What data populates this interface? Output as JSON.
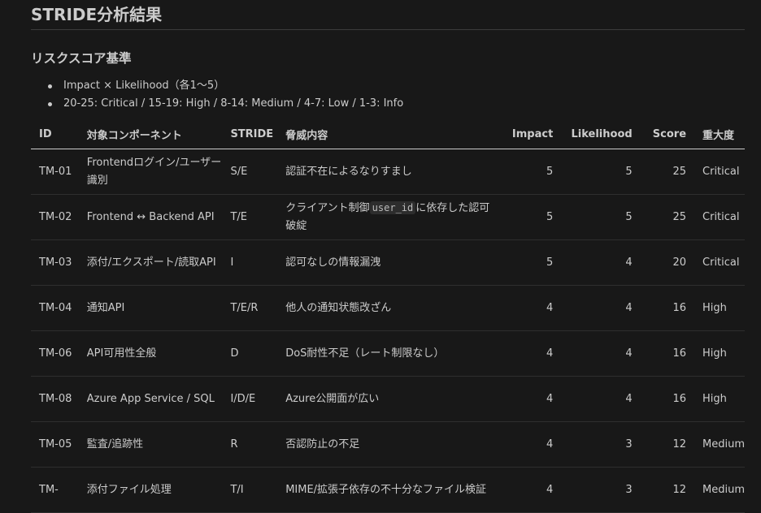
{
  "title": "STRIDE分析結果",
  "section": {
    "heading": "リスクスコア基準",
    "bullets": [
      "Impact × Likelihood（各1〜5）",
      "20-25: Critical / 15-19: High / 8-14: Medium / 4-7: Low / 1-3: Info"
    ]
  },
  "table": {
    "headers": [
      "ID",
      "対象コンポーネント",
      "STRIDE",
      "脅威内容",
      "Impact",
      "Likelihood",
      "Score",
      "重大度"
    ],
    "rows": [
      {
        "id": "TM-01",
        "component": "Frontendログイン/ユーザー識別",
        "stride": "S/E",
        "threat_pre": "認証不在によるなりすまし",
        "threat_code": "",
        "threat_post": "",
        "impact": "5",
        "likelihood": "5",
        "score": "25",
        "severity": "Critical"
      },
      {
        "id": "TM-02",
        "component": "Frontend ↔ Backend API",
        "stride": "T/E",
        "threat_pre": "クライアント制御",
        "threat_code": "user_id",
        "threat_post": "に依存した認可破綻",
        "impact": "5",
        "likelihood": "5",
        "score": "25",
        "severity": "Critical"
      },
      {
        "id": "TM-03",
        "component": "添付/エクスポート/読取API",
        "stride": "I",
        "threat_pre": "認可なしの情報漏洩",
        "threat_code": "",
        "threat_post": "",
        "impact": "5",
        "likelihood": "4",
        "score": "20",
        "severity": "Critical"
      },
      {
        "id": "TM-04",
        "component": "通知API",
        "stride": "T/E/R",
        "threat_pre": "他人の通知状態改ざん",
        "threat_code": "",
        "threat_post": "",
        "impact": "4",
        "likelihood": "4",
        "score": "16",
        "severity": "High"
      },
      {
        "id": "TM-06",
        "component": "API可用性全般",
        "stride": "D",
        "threat_pre": "DoS耐性不足（レート制限なし）",
        "threat_code": "",
        "threat_post": "",
        "impact": "4",
        "likelihood": "4",
        "score": "16",
        "severity": "High"
      },
      {
        "id": "TM-08",
        "component": "Azure App Service / SQL",
        "stride": "I/D/E",
        "threat_pre": "Azure公開面が広い",
        "threat_code": "",
        "threat_post": "",
        "impact": "4",
        "likelihood": "4",
        "score": "16",
        "severity": "High"
      },
      {
        "id": "TM-05",
        "component": "監査/追跡性",
        "stride": "R",
        "threat_pre": "否認防止の不足",
        "threat_code": "",
        "threat_post": "",
        "impact": "4",
        "likelihood": "3",
        "score": "12",
        "severity": "Medium"
      },
      {
        "id": "TM-",
        "component": "添付ファイル処理",
        "stride": "T/I",
        "threat_pre": "MIME/拡張子依存の不十分なファイル検証",
        "threat_code": "",
        "threat_post": "",
        "impact": "4",
        "likelihood": "3",
        "score": "12",
        "severity": "Medium"
      }
    ]
  }
}
